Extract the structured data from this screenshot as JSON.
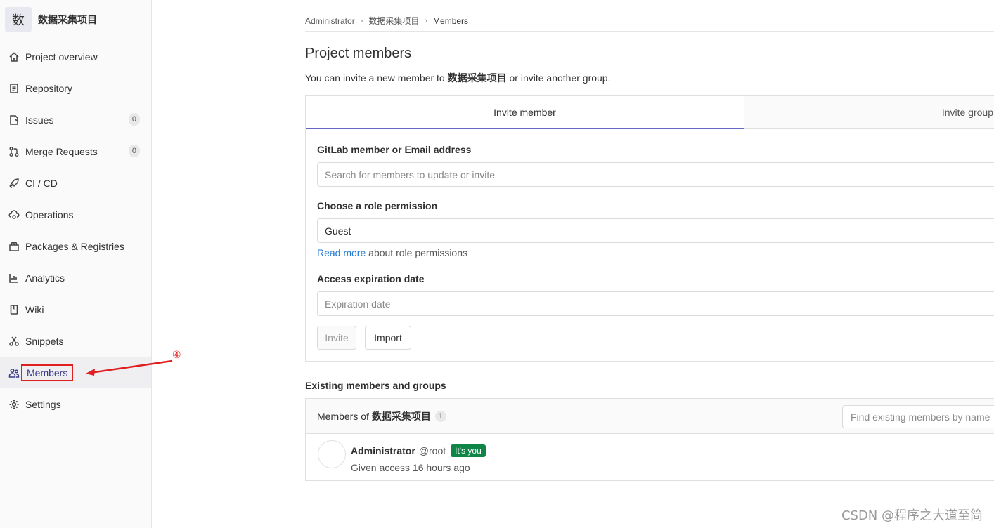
{
  "project": {
    "avatar_letter": "数",
    "name": "数据采集项目"
  },
  "sidebar": {
    "items": [
      {
        "label": "Project overview",
        "icon": "home-icon"
      },
      {
        "label": "Repository",
        "icon": "document-icon"
      },
      {
        "label": "Issues",
        "icon": "issues-icon",
        "count": "0"
      },
      {
        "label": "Merge Requests",
        "icon": "merge-request-icon",
        "count": "0"
      },
      {
        "label": "CI / CD",
        "icon": "rocket-icon"
      },
      {
        "label": "Operations",
        "icon": "cloud-gear-icon"
      },
      {
        "label": "Packages & Registries",
        "icon": "package-icon"
      },
      {
        "label": "Analytics",
        "icon": "chart-icon"
      },
      {
        "label": "Wiki",
        "icon": "book-icon"
      },
      {
        "label": "Snippets",
        "icon": "scissors-icon"
      },
      {
        "label": "Members",
        "icon": "users-icon"
      },
      {
        "label": "Settings",
        "icon": "gear-icon"
      }
    ]
  },
  "annotation": {
    "number": "④",
    "color": "#e02020"
  },
  "breadcrumb": {
    "items": [
      "Administrator",
      "数据采集项目",
      "Members"
    ]
  },
  "page": {
    "title": "Project members",
    "intro_prefix": "You can invite a new member to ",
    "intro_project": "数据采集项目",
    "intro_suffix": " or invite another group."
  },
  "tabs": {
    "invite_member": "Invite member",
    "invite_group": "Invite group"
  },
  "form": {
    "member_label": "GitLab member or Email address",
    "member_placeholder": "Search for members to update or invite",
    "role_label": "Choose a role permission",
    "role_value": "Guest",
    "read_more": "Read more",
    "read_more_suffix": " about role permissions",
    "expiration_label": "Access expiration date",
    "expiration_placeholder": "Expiration date",
    "invite_button": "Invite",
    "import_button": "Import"
  },
  "existing": {
    "title": "Existing members and groups",
    "members_of": "Members of",
    "project": "数据采集项目",
    "count": "1",
    "search_placeholder": "Find existing members by name",
    "members": [
      {
        "name": "Administrator",
        "handle": "@root",
        "badge": "It's you",
        "access": "Given access 16 hours ago"
      }
    ]
  },
  "watermark": "CSDN @程序之大道至简",
  "colors": {
    "accent": "#6666c4",
    "link": "#1f78d1",
    "badge_green": "#108548",
    "annotation_red": "#e02020"
  }
}
